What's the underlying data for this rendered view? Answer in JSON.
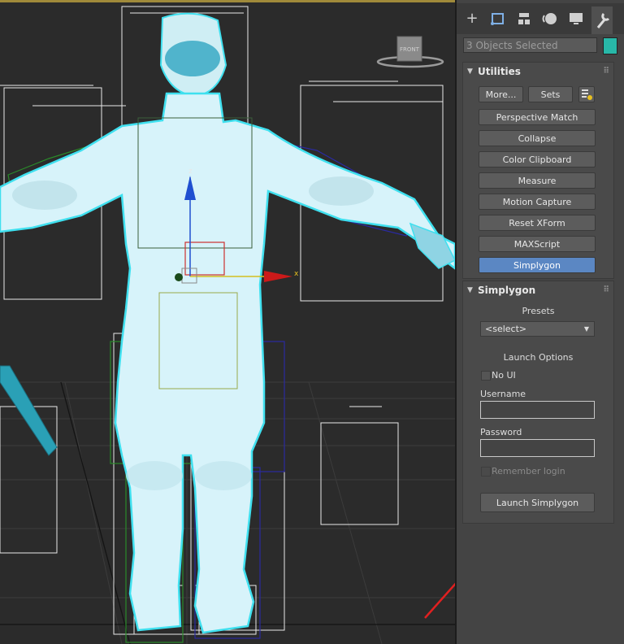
{
  "viewport": {
    "viewcube_label": "FRONT",
    "axis_z": "z",
    "axis_x": "x"
  },
  "command_panel": {
    "tabs": [
      {
        "name": "create-tab",
        "icon": "plus-icon"
      },
      {
        "name": "modify-tab",
        "icon": "modify-icon"
      },
      {
        "name": "hierarchy-tab",
        "icon": "hierarchy-icon"
      },
      {
        "name": "motion-tab",
        "icon": "motion-icon"
      },
      {
        "name": "display-tab",
        "icon": "display-icon"
      },
      {
        "name": "utilities-tab",
        "icon": "wrench-icon"
      }
    ],
    "selection_text": "3 Objects Selected",
    "object_color": "#28b8a8"
  },
  "utilities": {
    "title": "Utilities",
    "more_label": "More...",
    "sets_label": "Sets",
    "buttons": [
      "Perspective Match",
      "Collapse",
      "Color Clipboard",
      "Measure",
      "Motion Capture",
      "Reset XForm",
      "MAXScript",
      "Simplygon"
    ],
    "active_button": "Simplygon"
  },
  "simplygon": {
    "title": "Simplygon",
    "presets_label": "Presets",
    "presets_value": "<select>",
    "launch_options_label": "Launch Options",
    "no_ui_label": "No UI",
    "username_label": "Username",
    "username_value": "",
    "password_label": "Password",
    "password_value": "",
    "remember_login_label": "Remember login",
    "launch_button": "Launch Simplygon"
  },
  "annotation": {
    "arrow_color": "#e02020"
  }
}
